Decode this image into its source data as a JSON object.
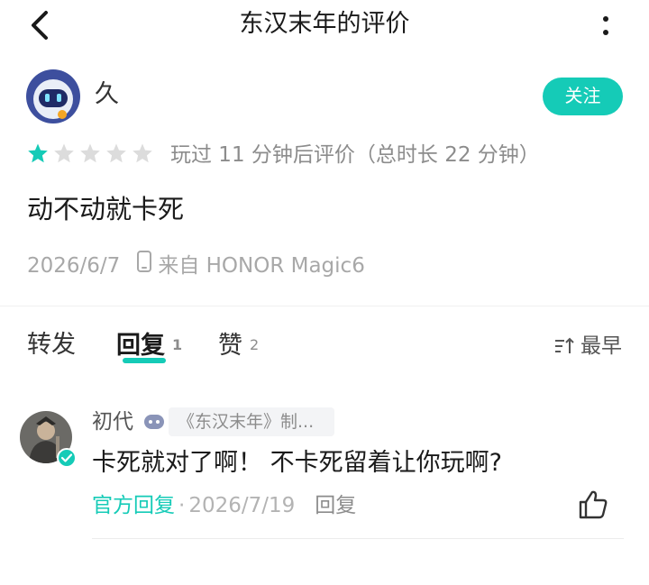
{
  "header": {
    "title": "东汉末年的评价"
  },
  "author": {
    "name": "久",
    "follow_label": "关注"
  },
  "rating": {
    "stars_filled": 1,
    "stars_total": 5,
    "playtime_text": "玩过 11 分钟后评价（总时长 22 分钟）"
  },
  "review": {
    "text": "动不动就卡死",
    "date": "2026/6/7",
    "device": "来自 HONOR Magic6"
  },
  "tabs": {
    "repost_label": "转发",
    "reply_label": "回复",
    "reply_count": "1",
    "like_label": "赞",
    "like_count": "2",
    "sort_label": "最早"
  },
  "reply": {
    "name": "初代",
    "tag": "《东汉末年》制...",
    "text": "卡死就对了啊！ 不卡死留着让你玩啊?",
    "official_label": "官方回复",
    "dot": "·",
    "date": "2026/7/19",
    "reply_label": "回复"
  },
  "colors": {
    "accent": "#15cbb7",
    "star_filled": "#15cbb7",
    "star_empty": "#dcdcdc"
  },
  "icons": [
    "back-arrow-icon",
    "more-icon",
    "star-icon",
    "phone-icon",
    "sort-icon",
    "game-controller-icon",
    "verified-icon",
    "thumbs-up-icon"
  ]
}
